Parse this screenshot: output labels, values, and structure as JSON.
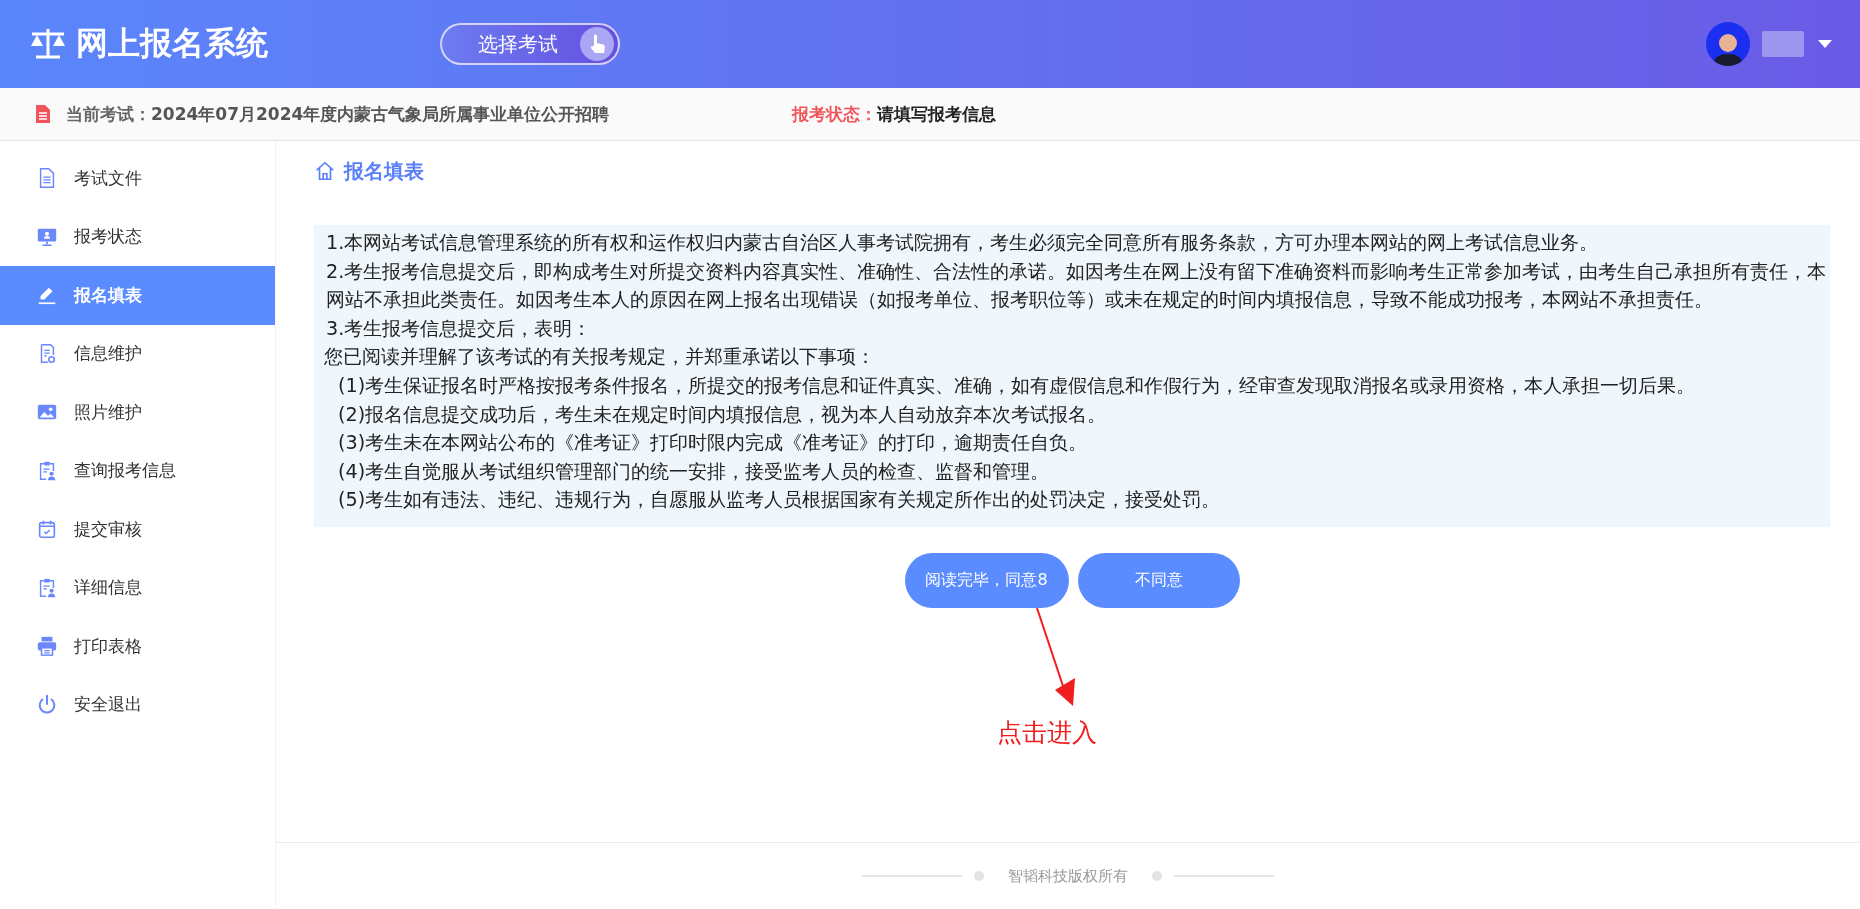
{
  "header": {
    "logo_text": "网上报名系统",
    "select_exam_button": "选择考试"
  },
  "exam_bar": {
    "current_exam_label": "当前考试：",
    "current_exam": "2024年07月2024年度内蒙古气象局所属事业单位公开招聘",
    "status_label": "报考状态：",
    "status": "请填写报考信息"
  },
  "sidebar": {
    "items": [
      {
        "label": "考试文件",
        "kind": "document",
        "selected": false
      },
      {
        "label": "报考状态",
        "kind": "monitor",
        "selected": false
      },
      {
        "label": "报名填表",
        "kind": "pencil",
        "selected": true
      },
      {
        "label": "信息维护",
        "kind": "maintenance",
        "selected": false
      },
      {
        "label": "照片维护",
        "kind": "photo",
        "selected": false
      },
      {
        "label": "查询报考信息",
        "kind": "query",
        "selected": false
      },
      {
        "label": "提交审核",
        "kind": "submit",
        "selected": false
      },
      {
        "label": "详细信息",
        "kind": "query",
        "selected": false
      },
      {
        "label": "打印表格",
        "kind": "print",
        "selected": false
      },
      {
        "label": "安全退出",
        "kind": "logout",
        "selected": false
      }
    ]
  },
  "page_title": "报名填表",
  "terms": [
    {
      "kind": "clause",
      "text": "1.本网站考试信息管理系统的所有权和运作权归内蒙古自治区人事考试院拥有，考生必须完全同意所有服务条款，方可办理本网站的网上考试信息业务。"
    },
    {
      "kind": "clause",
      "text": "2.考生报考信息提交后，即构成考生对所提交资料内容真实性、准确性、合法性的承诺。如因考生在网上没有留下准确资料而影响考生正常参加考试，由考生自己承担所有责任，本网站不承担此类责任。如因考生本人的原因在网上报名出现错误（如报考单位、报考职位等）或未在规定的时间内填报信息，导致不能成功报考，本网站不承担责任。"
    },
    {
      "kind": "clause",
      "text": "3.考生报考信息提交后，表明："
    },
    {
      "kind": "intro",
      "text": "您已阅读并理解了该考试的有关报考规定，并郑重承诺以下事项："
    },
    {
      "kind": "sub",
      "text": "(1)考生保证报名时严格按报考条件报名，所提交的报考信息和证件真实、准确，如有虚假信息和作假行为，经审查发现取消报名或录用资格，本人承担一切后果。"
    },
    {
      "kind": "sub",
      "text": "(2)报名信息提交成功后，考生未在规定时间内填报信息，视为本人自动放弃本次考试报名。"
    },
    {
      "kind": "sub",
      "text": "(3)考生未在本网站公布的《准考证》打印时限内完成《准考证》的打印，逾期责任自负。"
    },
    {
      "kind": "sub",
      "text": "(4)考生自觉服从考试组织管理部门的统一安排，接受监考人员的检查、监督和管理。"
    },
    {
      "kind": "sub",
      "text": "(5)考生如有违法、违纪、违规行为，自愿服从监考人员根据国家有关规定所作出的处罚决定，接受处罚。"
    }
  ],
  "buttons": [
    "阅读完毕，同意8",
    "不同意"
  ],
  "annotation": "点击进入",
  "footer": "智韬科技版权所有"
}
